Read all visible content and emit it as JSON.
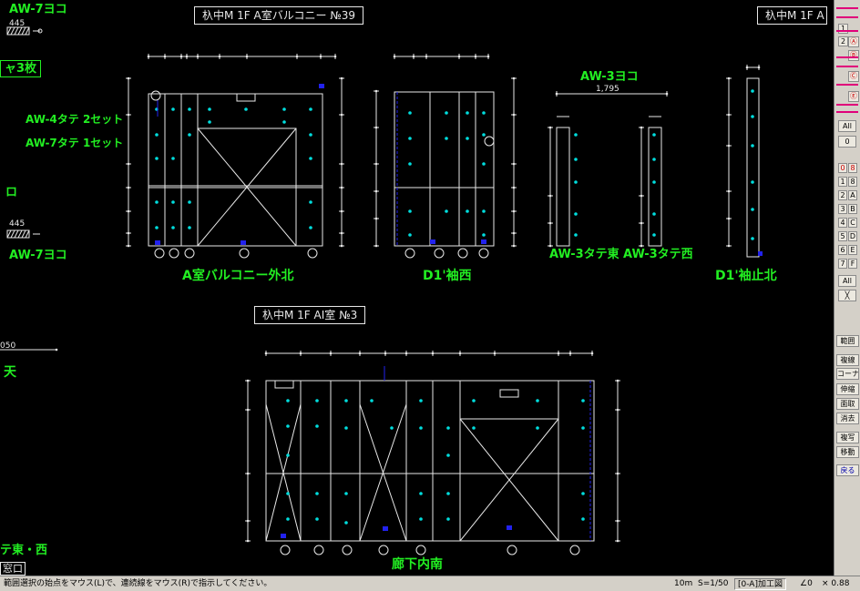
{
  "labels": {
    "aw7yoko_top": "AW-7ヨコ",
    "dim_445_top": "445",
    "sheets3": "ャ3枚",
    "aw4tate": "AW-4タテ 2セット",
    "aw7tate": "AW-7タテ 1セット",
    "kuchi": "ロ",
    "dim_445_mid": "445",
    "aw7yoko_mid": "AW-7ヨコ",
    "dim_050": "050",
    "ten": "天",
    "tate_higashi_nishi": "テ東・西",
    "ma_kuchi": "窓口",
    "title_a": "杁中M  1F  A室バルコニー  №39",
    "title_right": "杁中M 1F A",
    "aw3yoko": "AW-3ヨコ",
    "aw3yoko_dim": "1,795",
    "title_b": "杁中M  1F  AI室  №3",
    "cap_a": "A室バルコニー外北",
    "cap_d1west": "D1'袖西",
    "cap_aw3east": "AW-3タテ東",
    "cap_aw3west": "AW-3タテ西",
    "cap_d1north": "D1'袖止北",
    "cap_corridor": "廊下内南"
  },
  "toolbar": {
    "buttons": [
      "1",
      "2",
      "Ⓐ",
      "Ⓑ",
      "Ⓒ",
      "Ⓔ",
      "All",
      "0",
      "0",
      "8",
      "1",
      "8",
      "2",
      "A",
      "3",
      "B",
      "4",
      "C",
      "5",
      "D",
      "6",
      "E",
      "7",
      "F",
      "All",
      "╳",
      "範囲",
      "複線",
      "コーナー",
      "伸縮",
      "面取",
      "消去",
      "複写",
      "移動",
      "戻る"
    ]
  },
  "status": {
    "message": "範囲選択の始点をマウス(L)で、連続線をマウス(R)で指示してください。",
    "scale_unit": "10m",
    "scale": "S=1/50",
    "layer": "[0-A]加工図",
    "angle": "∠0",
    "factor": "× 0.88"
  },
  "colors": {
    "background": "#000000",
    "line": "#e8e8e8",
    "label_green": "#22ee22",
    "anchor_cyan": "#00dddd",
    "marker_blue": "#2222ee"
  }
}
